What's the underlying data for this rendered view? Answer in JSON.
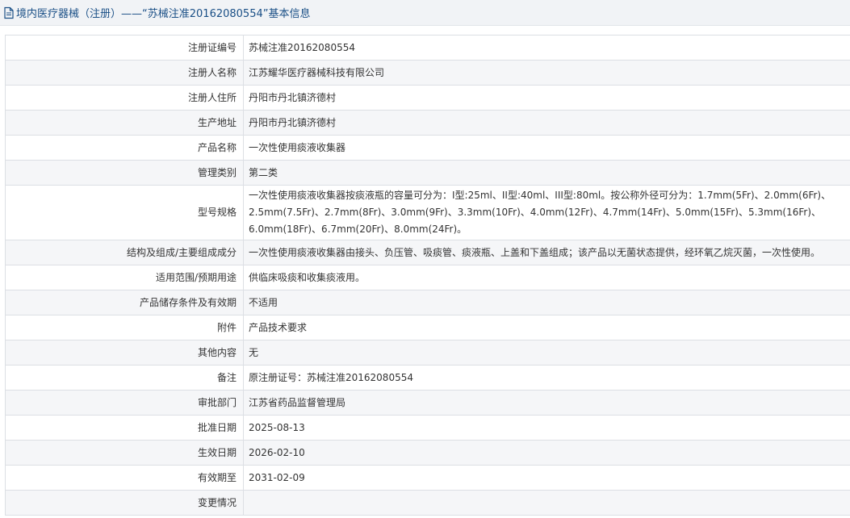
{
  "header": {
    "title": "境内医疗器械（注册）",
    "separator": " ——“苏械注准20162080554”基本信息"
  },
  "rows": [
    {
      "label": "注册证编号",
      "value": "苏械注准20162080554"
    },
    {
      "label": "注册人名称",
      "value": "江苏耀华医疗器械科技有限公司"
    },
    {
      "label": "注册人住所",
      "value": "丹阳市丹北镇济德村"
    },
    {
      "label": "生产地址",
      "value": "丹阳市丹北镇济德村"
    },
    {
      "label": "产品名称",
      "value": "一次性使用痰液收集器"
    },
    {
      "label": "管理类别",
      "value": "第二类"
    },
    {
      "label": "型号规格",
      "value": "一次性使用痰液收集器按痰液瓶的容量可分为：I型:25ml、II型:40ml、III型:80ml。按公称外径可分为：1.7mm(5Fr)、2.0mm(6Fr)、2.5mm(7.5Fr)、2.7mm(8Fr)、3.0mm(9Fr)、3.3mm(10Fr)、4.0mm(12Fr)、4.7mm(14Fr)、5.0mm(15Fr)、5.3mm(16Fr)、6.0mm(18Fr)、6.7mm(20Fr)、8.0mm(24Fr)。"
    },
    {
      "label": "结构及组成/主要组成成分",
      "value": "一次性使用痰液收集器由接头、负压管、吸痰管、痰液瓶、上盖和下盖组成；该产品以无菌状态提供，经环氧乙烷灭菌，一次性使用。"
    },
    {
      "label": "适用范围/预期用途",
      "value": "供临床吸痰和收集痰液用。"
    },
    {
      "label": "产品储存条件及有效期",
      "value": "不适用"
    },
    {
      "label": "附件",
      "value": "产品技术要求"
    },
    {
      "label": "其他内容",
      "value": "无"
    },
    {
      "label": "备注",
      "value": "原注册证号：苏械注准20162080554"
    },
    {
      "label": "审批部门",
      "value": "江苏省药品监督管理局"
    },
    {
      "label": "批准日期",
      "value": "2025-08-13"
    },
    {
      "label": "生效日期",
      "value": "2026-02-10"
    },
    {
      "label": "有效期至",
      "value": "2031-02-09"
    },
    {
      "label": "变更情况",
      "value": ""
    }
  ]
}
